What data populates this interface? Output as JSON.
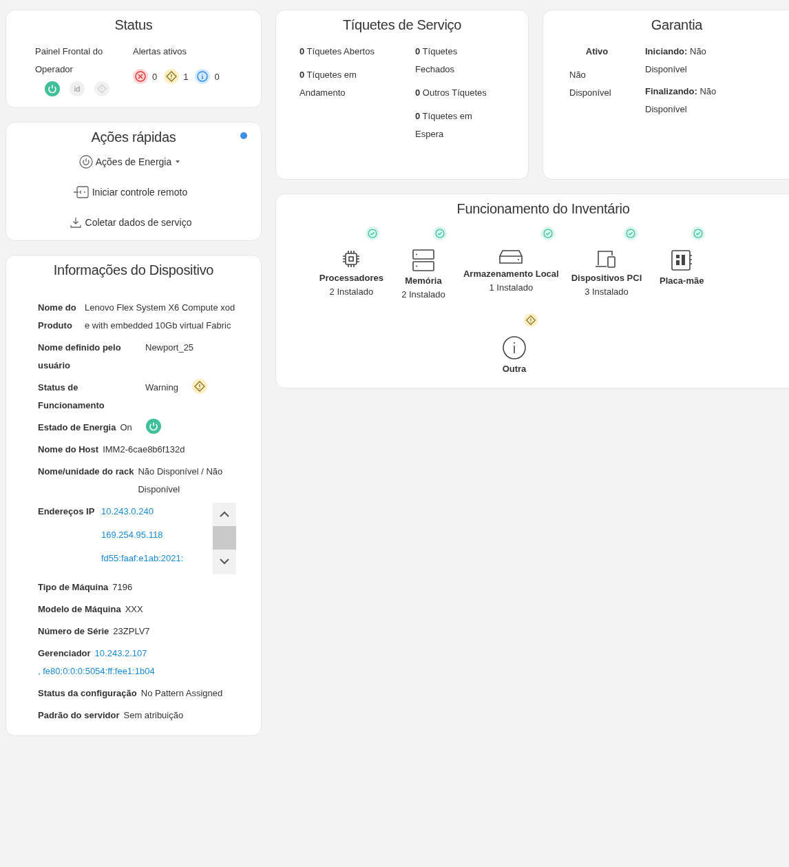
{
  "status": {
    "title": "Status",
    "front_panel": {
      "label": "Painel Frontal do Operador",
      "indicators": [
        {
          "kind": "power",
          "on": true
        },
        {
          "kind": "id",
          "label": "id",
          "on": false
        },
        {
          "kind": "fault",
          "on": false
        }
      ]
    },
    "alerts": {
      "label": "Alertas ativos",
      "items": [
        {
          "kind": "error",
          "count": "0"
        },
        {
          "kind": "warning",
          "count": "1"
        },
        {
          "kind": "info",
          "count": "0"
        }
      ]
    }
  },
  "tickets": {
    "title": "Tíquetes de Serviço",
    "columns": [
      [
        "**0** Tíquetes Abertos",
        "**0** Tíquetes em Andamento"
      ],
      [
        "**0** Tíquetes Fechados",
        "**0** Outros Tíquetes",
        "**0** Tíquetes em Espera"
      ]
    ]
  },
  "warranty": {
    "title": "Garantia",
    "state_label": "Ativo",
    "state_value": "Não Disponível",
    "dates": [
      "**Iniciando:** Não Disponível",
      "**Finalizando:** Não Disponível"
    ]
  },
  "quick_actions": {
    "title": "Ações rápidas",
    "help_badge": true,
    "items": [
      {
        "kind": "power",
        "label": "Ações de Energia",
        "dropdown": true
      },
      {
        "kind": "remote",
        "label": "Iniciar controle remoto",
        "dropdown": false
      },
      {
        "kind": "download",
        "label": "Coletar dados de serviço",
        "dropdown": false
      }
    ]
  },
  "inventory": {
    "title": "Funcionamento do Inventário",
    "items": [
      {
        "kind": "cpu",
        "name": "Processadores",
        "count": "2 Instalado",
        "warning": false
      },
      {
        "kind": "memory",
        "name": "Memória",
        "count": "2 Instalado",
        "warning": false
      },
      {
        "kind": "storage",
        "name": "Armazenamento Local",
        "count": "1 Instalado",
        "warning": false
      },
      {
        "kind": "pci",
        "name": "Dispositivos PCI",
        "count": "3 Instalado",
        "warning": false
      },
      {
        "kind": "board",
        "name": "Placa-mãe",
        "warning": false
      },
      {
        "kind": "other",
        "name": "Outra",
        "warning": true
      }
    ]
  },
  "device_info": {
    "title": "Informações do Dispositivo",
    "rows": [
      {
        "kind": "text",
        "label": "Nome do Produto",
        "value": "Lenovo Flex System X6 Compute xode with embedded 10Gb virtual Fabric"
      },
      {
        "kind": "text",
        "label": "Nome definido pelo usuário",
        "value": "Newport_25"
      },
      {
        "kind": "health",
        "label": "Status de Funcionamento",
        "value": "Warning",
        "warning": true
      },
      {
        "kind": "power",
        "label": "Estado de Energia",
        "value": "On",
        "on": true
      },
      {
        "kind": "text",
        "label": "Nome do Host",
        "value": "IMM2-6cae8b6f132d"
      },
      {
        "kind": "text",
        "label": "Nome/unidade do rack",
        "value": "Não Disponível / Não Disponível"
      },
      {
        "kind": "scroll",
        "label": "Endereços IP",
        "values": [
          "10.243.0.240",
          "169.254.95.118",
          "fd55:faaf:e1ab:2021:"
        ]
      },
      {
        "kind": "text",
        "label": "Tipo de Máquina",
        "value": "7196"
      },
      {
        "kind": "text",
        "label": "Modelo de Máquina",
        "value": "XXX"
      },
      {
        "kind": "text",
        "label": "Número de Série",
        "value": "23ZPLV7"
      },
      {
        "kind": "links",
        "label": "Gerenciador",
        "values": [
          "10.243.2.107",
          ", fe80:0:0:0:5054:ff:fee1:1b04"
        ]
      },
      {
        "kind": "text",
        "label": "Status da configuração",
        "value": "No Pattern Assigned"
      },
      {
        "kind": "text",
        "label": "Padrão do servidor",
        "value": "Sem atribuição"
      }
    ]
  }
}
